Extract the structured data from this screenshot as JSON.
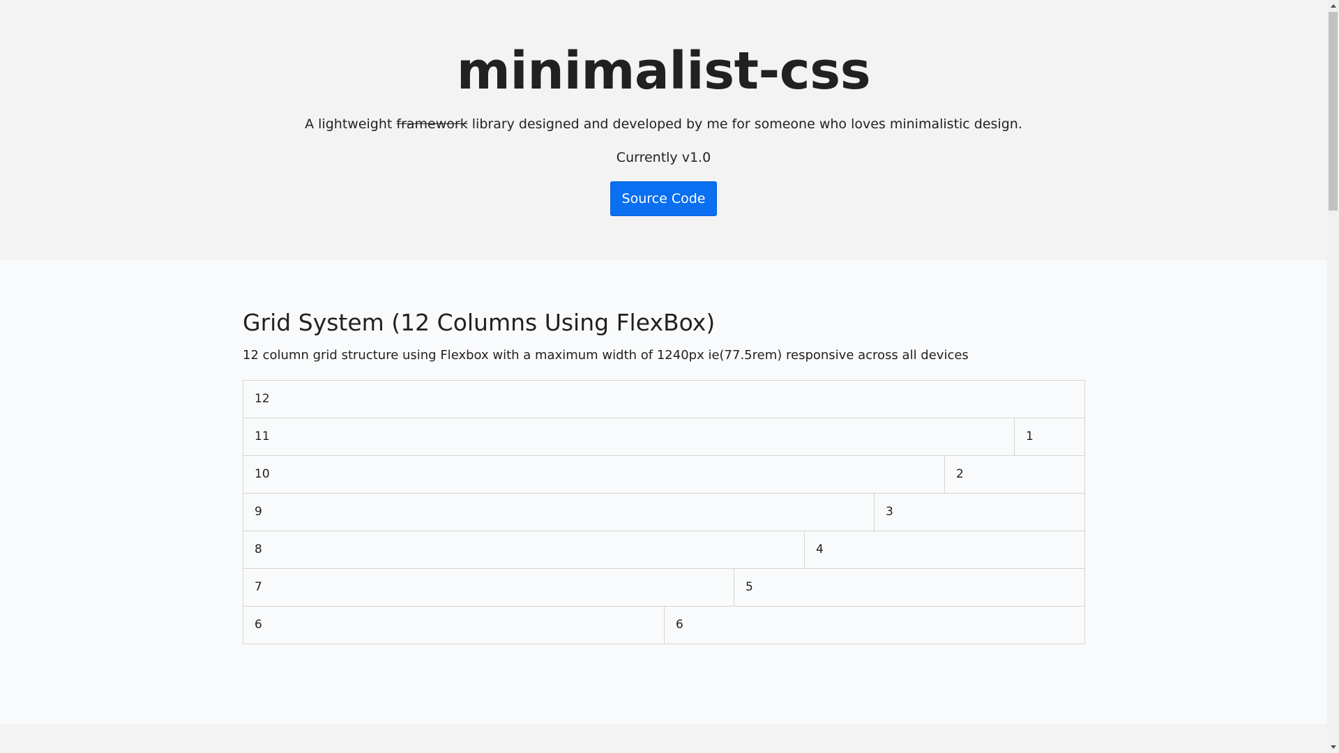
{
  "header": {
    "title": "minimalist-css",
    "tagline_prefix": "A lightweight ",
    "tagline_struck": "framework",
    "tagline_suffix": " library designed and developed by me for someone who loves minimalistic design.",
    "version": "Currently v1.0",
    "source_button": "Source Code",
    "button_color": "#0a6ff0"
  },
  "grid_section": {
    "title": "Grid System (12 Columns Using FlexBox)",
    "description": "12 column grid structure using Flexbox with a maximum width of 1240px ie(77.5rem) responsive across all devices",
    "rows": [
      [
        "12"
      ],
      [
        "11",
        "1"
      ],
      [
        "10",
        "2"
      ],
      [
        "9",
        "3"
      ],
      [
        "8",
        "4"
      ],
      [
        "7",
        "5"
      ],
      [
        "6",
        "6"
      ]
    ]
  }
}
